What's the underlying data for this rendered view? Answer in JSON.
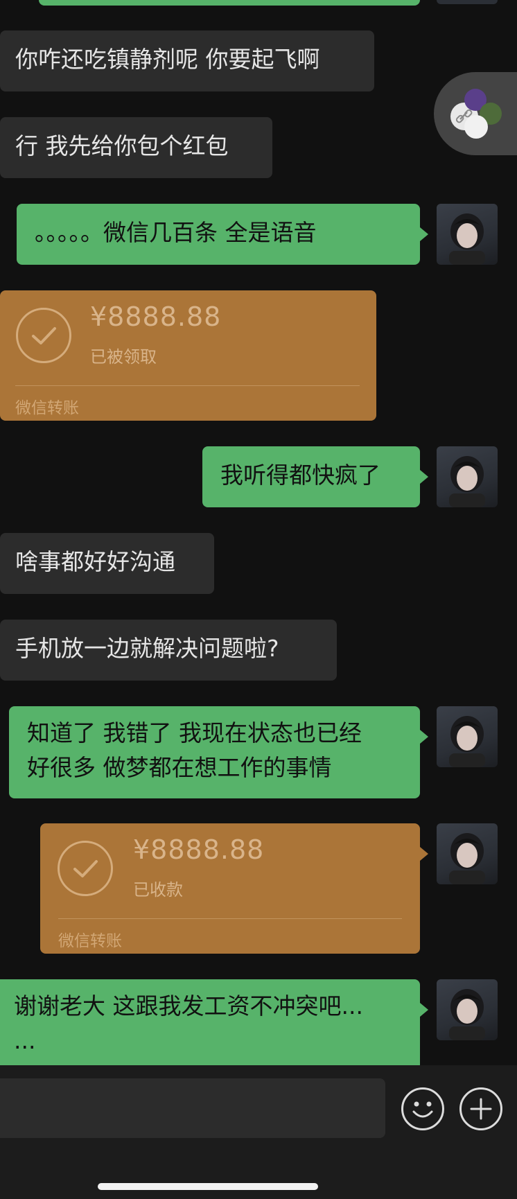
{
  "messages": [
    {
      "text": "你咋还吃镇静剂呢 你要起飞啊"
    },
    {
      "text": "行 我先给你包个红包"
    },
    {
      "text": "。。。。。微信几百条 全是语音"
    },
    {
      "amount": "¥8888.88",
      "status": "已被领取",
      "label": "微信转账"
    },
    {
      "text": "我听得都快疯了"
    },
    {
      "text": "啥事都好好沟通"
    },
    {
      "text": "手机放一边就解决问题啦?"
    },
    {
      "line1": "知道了 我错了 我现在状态也已经",
      "line2": "好很多 做梦都在想工作的事情"
    },
    {
      "amount": "¥8888.88",
      "status": "已收款",
      "label": "微信转账"
    },
    {
      "line1": "谢谢老大 这跟我发工资不冲突吧...",
      "line2": "..."
    }
  ],
  "input": {
    "placeholder": ""
  },
  "icons": {
    "emoji": "emoji-icon",
    "plus": "plus-icon",
    "check": "check-icon"
  },
  "colors": {
    "background": "#111111",
    "incoming_bubble": "#2c2c2c",
    "outgoing_bubble": "#57b36a",
    "transfer_card": "#ab7538"
  }
}
